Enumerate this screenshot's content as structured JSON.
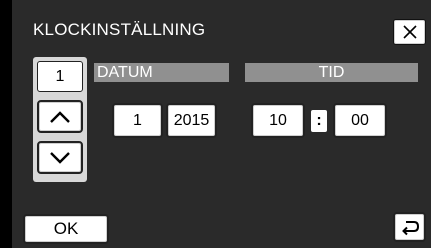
{
  "window": {
    "title": "KLOCKINSTÄLLNING"
  },
  "selector": {
    "current_value": "1"
  },
  "date": {
    "label": "DATUM",
    "day": "1",
    "year": "2015"
  },
  "time": {
    "label": "TID",
    "hour": "10",
    "separator": ":",
    "minute": "00"
  },
  "footer": {
    "ok_label": "OK"
  },
  "icons": {
    "close": "close-icon",
    "up": "chevron-up-icon",
    "down": "chevron-down-icon",
    "back": "return-icon"
  }
}
